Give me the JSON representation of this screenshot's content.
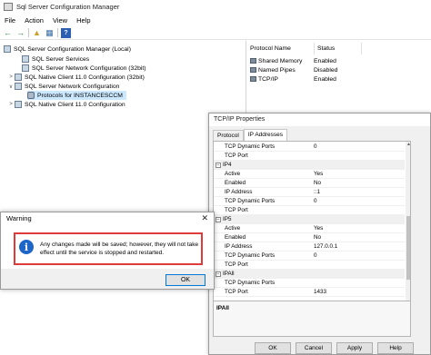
{
  "window": {
    "title": "Sql Server Configuration Manager"
  },
  "menu": [
    "File",
    "Action",
    "View",
    "Help"
  ],
  "tree": {
    "root": "SQL Server Configuration Manager (Local)",
    "items": [
      {
        "label": "SQL Server Services"
      },
      {
        "label": "SQL Server Network Configuration (32bit)"
      },
      {
        "label": "SQL Native Client 11.0 Configuration (32bit)"
      },
      {
        "label": "SQL Server Network Configuration"
      },
      {
        "label": "Protocols for INSTANCESCCM"
      },
      {
        "label": "SQL Native Client 11.0 Configuration"
      }
    ]
  },
  "list": {
    "columns": [
      "Protocol Name",
      "Status"
    ],
    "rows": [
      {
        "name": "Shared Memory",
        "status": "Enabled"
      },
      {
        "name": "Named Pipes",
        "status": "Disabled"
      },
      {
        "name": "TCP/IP",
        "status": "Enabled"
      }
    ]
  },
  "tcp_dialog": {
    "title": "TCP/IP Properties",
    "tabs": [
      "Protocol",
      "IP Addresses"
    ],
    "rows": [
      {
        "type": "prop",
        "key": "TCP Dynamic Ports",
        "value": "0"
      },
      {
        "type": "prop",
        "key": "TCP Port",
        "value": ""
      },
      {
        "type": "cat",
        "key": "IP4",
        "value": ""
      },
      {
        "type": "prop",
        "key": "Active",
        "value": "Yes"
      },
      {
        "type": "prop",
        "key": "Enabled",
        "value": "No"
      },
      {
        "type": "prop",
        "key": "IP Address",
        "value": "::1"
      },
      {
        "type": "prop",
        "key": "TCP Dynamic Ports",
        "value": "0"
      },
      {
        "type": "prop",
        "key": "TCP Port",
        "value": ""
      },
      {
        "type": "cat",
        "key": "IP5",
        "value": ""
      },
      {
        "type": "prop",
        "key": "Active",
        "value": "Yes"
      },
      {
        "type": "prop",
        "key": "Enabled",
        "value": "No"
      },
      {
        "type": "prop",
        "key": "IP Address",
        "value": "127.0.0.1"
      },
      {
        "type": "prop",
        "key": "TCP Dynamic Ports",
        "value": "0"
      },
      {
        "type": "prop",
        "key": "TCP Port",
        "value": ""
      },
      {
        "type": "cat",
        "key": "IPAll",
        "value": ""
      },
      {
        "type": "prop",
        "key": "TCP Dynamic Ports",
        "value": ""
      },
      {
        "type": "prop",
        "key": "TCP Port",
        "value": "1433"
      }
    ],
    "description_label": "IPAll",
    "buttons": [
      "OK",
      "Cancel",
      "Apply",
      "Help"
    ]
  },
  "warning": {
    "title": "Warning",
    "message": "Any changes made will be saved; however, they will not take effect until the service is stopped and restarted.",
    "ok_label": "OK",
    "highlight_color": "#e03b3b"
  }
}
